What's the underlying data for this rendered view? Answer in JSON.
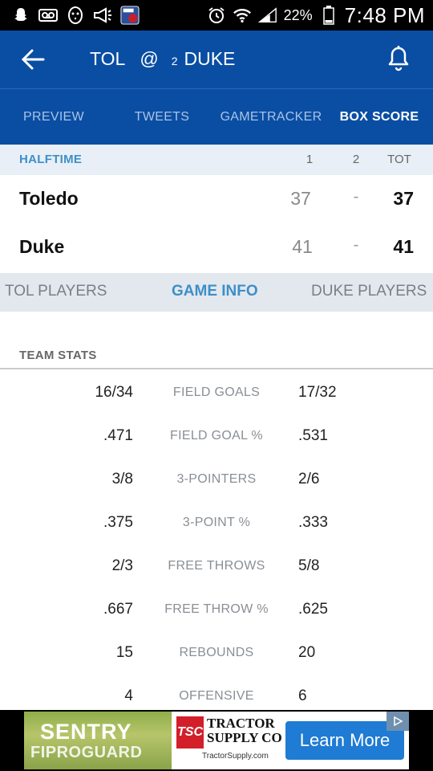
{
  "status_bar": {
    "battery_pct": "22%",
    "time": "7:48 PM",
    "left_icons": [
      "snapchat-icon",
      "voicemail-icon",
      "hockey-mask-icon",
      "megaphone-icon",
      "pba-app-icon"
    ],
    "right_icons": [
      "alarm-icon",
      "wifi-icon",
      "signal-icon",
      "battery-icon"
    ]
  },
  "header": {
    "away": "TOL",
    "at": "@",
    "home_rank": "2",
    "home": "DUKE",
    "back_icon": "arrow-left-icon",
    "notify_icon": "bell-icon"
  },
  "tabs": [
    {
      "label": "PREVIEW",
      "active": false
    },
    {
      "label": "TWEETS",
      "active": false
    },
    {
      "label": "GAMETRACKER",
      "active": false
    },
    {
      "label": "BOX SCORE",
      "active": true
    }
  ],
  "scoreboard": {
    "status": "HALFTIME",
    "columns": [
      "1",
      "2",
      "TOT"
    ],
    "teams": [
      {
        "name": "Toledo",
        "h1": "37",
        "h2": "-",
        "tot": "37"
      },
      {
        "name": "Duke",
        "h1": "41",
        "h2": "-",
        "tot": "41"
      }
    ]
  },
  "subtabs": [
    {
      "label": "TOL PLAYERS",
      "active": false
    },
    {
      "label": "GAME INFO",
      "active": true
    },
    {
      "label": "DUKE PLAYERS",
      "active": false
    }
  ],
  "team_stats": {
    "title": "TEAM STATS",
    "rows": [
      {
        "left": "16/34",
        "label": "FIELD GOALS",
        "right": "17/32"
      },
      {
        "left": ".471",
        "label": "FIELD GOAL %",
        "right": ".531"
      },
      {
        "left": "3/8",
        "label": "3-POINTERS",
        "right": "2/6"
      },
      {
        "left": ".375",
        "label": "3-POINT %",
        "right": ".333"
      },
      {
        "left": "2/3",
        "label": "FREE THROWS",
        "right": "5/8"
      },
      {
        "left": ".667",
        "label": "FREE THROW %",
        "right": ".625"
      },
      {
        "left": "15",
        "label": "REBOUNDS",
        "right": "20"
      },
      {
        "left": "4",
        "label": "OFFENSIVE",
        "right": "6"
      }
    ]
  },
  "ad": {
    "brand_line1": "SENTRY",
    "brand_line2": "FIPROGUARD",
    "tsc_logo": "TSC",
    "tractor_line1": "TRACTOR",
    "tractor_line2": "SUPPLY CO",
    "url": "TractorSupply.com",
    "cta": "Learn More",
    "choice_icon": "adchoices-icon"
  },
  "colors": {
    "app_blue": "#0a4ea3",
    "accent_blue": "#3d8fc8",
    "subtab_bg": "#e3e8ee",
    "score_head_bg": "#e8eff7"
  }
}
